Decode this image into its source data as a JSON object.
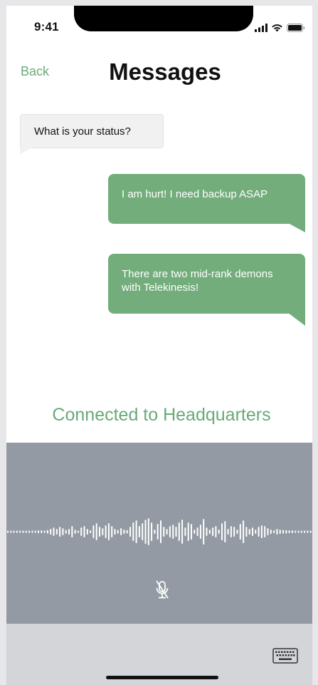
{
  "status_bar": {
    "time": "9:41",
    "icons": [
      "cellular-signal-icon",
      "wifi-icon",
      "battery-icon"
    ]
  },
  "header": {
    "back_label": "Back",
    "title": "Messages"
  },
  "messages": [
    {
      "direction": "incoming",
      "text": "What is your status?"
    },
    {
      "direction": "outgoing",
      "text": "I am hurt! I need backup ASAP"
    },
    {
      "direction": "outgoing",
      "text": "There are two mid-rank demons with Telekinesis!"
    }
  ],
  "connection_status": "Connected to Headquarters",
  "voice_panel": {
    "icons": [
      "waveform-icon",
      "microphone-muted-icon"
    ]
  },
  "bottom_bar": {
    "icons": [
      "keyboard-icon"
    ]
  },
  "colors": {
    "accent_green": "#6aa978",
    "bubble_green": "#72ad7b",
    "incoming_bubble": "#f1f1f1",
    "voice_panel": "#939aa3",
    "bottom_bar": "#d3d5d9"
  }
}
